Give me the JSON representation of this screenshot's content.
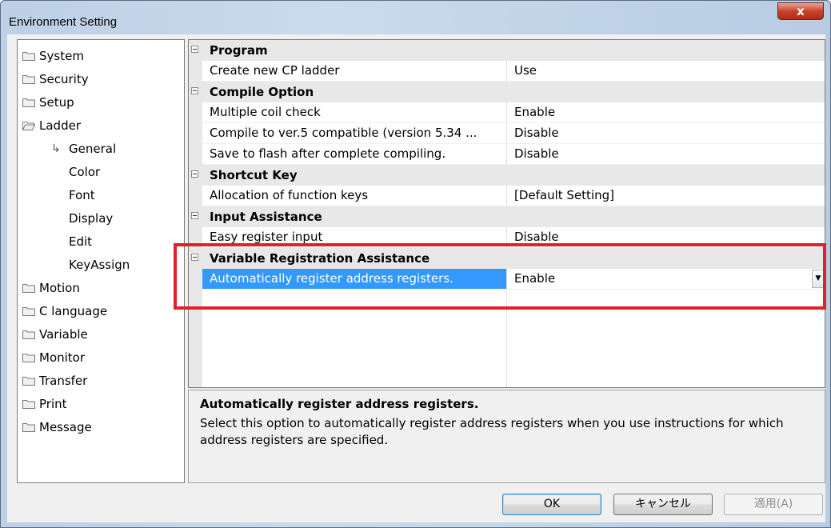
{
  "window": {
    "title": "Environment Setting",
    "close_glyph": "x"
  },
  "tree": {
    "items": [
      {
        "label": "System",
        "kind": "folder"
      },
      {
        "label": "Security",
        "kind": "folder"
      },
      {
        "label": "Setup",
        "kind": "folder"
      },
      {
        "label": "Ladder",
        "kind": "folder-open"
      },
      {
        "label": "General",
        "kind": "child-selected"
      },
      {
        "label": "Color",
        "kind": "child"
      },
      {
        "label": "Font",
        "kind": "child"
      },
      {
        "label": "Display",
        "kind": "child"
      },
      {
        "label": "Edit",
        "kind": "child"
      },
      {
        "label": "KeyAssign",
        "kind": "child"
      },
      {
        "label": "Motion",
        "kind": "folder"
      },
      {
        "label": "C language",
        "kind": "folder"
      },
      {
        "label": "Variable",
        "kind": "folder"
      },
      {
        "label": "Monitor",
        "kind": "folder"
      },
      {
        "label": "Transfer",
        "kind": "folder"
      },
      {
        "label": "Print",
        "kind": "folder"
      },
      {
        "label": "Message",
        "kind": "folder"
      }
    ]
  },
  "grid": {
    "categories": [
      {
        "label": "Program",
        "props": [
          {
            "name": "Create new CP ladder",
            "value": "Use"
          }
        ]
      },
      {
        "label": "Compile Option",
        "props": [
          {
            "name": "Multiple coil check",
            "value": "Enable"
          },
          {
            "name": "Compile to ver.5 compatible (version 5.34 ...",
            "value": "Disable"
          },
          {
            "name": "Save to flash after complete compiling.",
            "value": "Disable"
          }
        ]
      },
      {
        "label": "Shortcut Key",
        "props": [
          {
            "name": "Allocation of function keys",
            "value": "[Default Setting]"
          }
        ]
      },
      {
        "label": "Input Assistance",
        "props": [
          {
            "name": "Easy register input",
            "value": "Disable"
          }
        ]
      },
      {
        "label": "Variable Registration Assistance",
        "props": [
          {
            "name": "Automatically register address registers.",
            "value": "Enable"
          }
        ]
      }
    ]
  },
  "help": {
    "title": "Automatically register address registers.",
    "description": "Select this option to automatically register address registers when you use instructions for which address registers are specified."
  },
  "buttons": {
    "ok": "OK",
    "cancel": "キャンセル",
    "apply": "適用(A)"
  },
  "colors": {
    "selection": "#3399ff",
    "highlight_box": "#e0202a"
  }
}
